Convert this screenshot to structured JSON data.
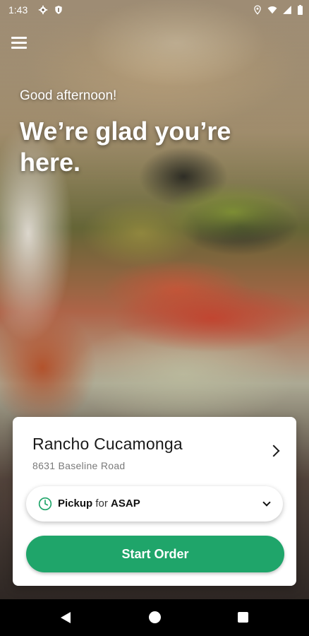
{
  "status_bar": {
    "time": "1:43",
    "icons": [
      "settings-icon",
      "shield-icon",
      "location-icon",
      "wifi-icon",
      "signal-icon",
      "battery-icon"
    ]
  },
  "header": {
    "menu_icon": "menu-icon",
    "greeting": "Good afternoon!",
    "headline": "We’re glad you’re here."
  },
  "card": {
    "location_name": "Rancho Cucamonga",
    "location_address": "8631 Baseline Road",
    "pickup": {
      "icon": "clock-icon",
      "mode": "Pickup",
      "connector": "for",
      "time": "ASAP"
    },
    "start_order_label": "Start Order"
  },
  "colors": {
    "accent": "#1fa56a",
    "card_bg": "#ffffff"
  },
  "nav_bar": {
    "icons": [
      "back-icon",
      "home-icon",
      "recents-icon"
    ]
  }
}
